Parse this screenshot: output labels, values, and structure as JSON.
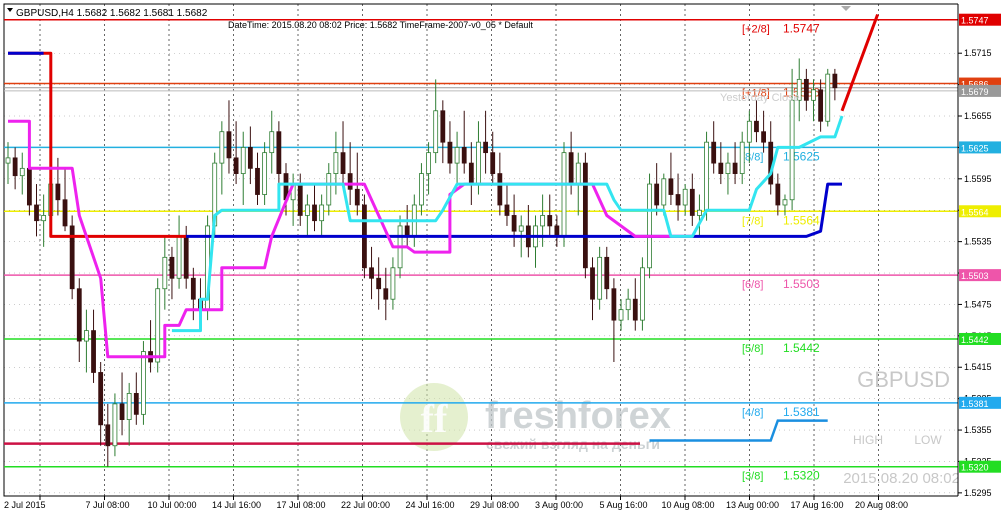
{
  "window": {
    "symbol_header": "GBPUSD,H4  1.5682 1.5682 1.5681 1.5682",
    "info_line": "DateTime: 2015.08.20 08:02    Price: 1.5682    TimeFrame-2007-v0_05    *    Default",
    "watermark_symbol": "GBPUSD",
    "watermark_datetime": "2015.08.20 08:02",
    "high_label": "HIGH",
    "low_label": "LOW",
    "logo_brand": "freshforex",
    "logo_tagline": "свежий взгляд на деньги",
    "yesterday_close_text": "Yesterday Close"
  },
  "colors": {
    "background": "#ffffff",
    "candle_bull": "#2e7d32",
    "candle_bear": "#3a1010",
    "red_line": "#e00000",
    "blue_line": "#0000cc",
    "cyan_line": "#33e5f0",
    "magenta_line": "#ee22ee",
    "grid": "#000000"
  },
  "chart_data": {
    "type": "candlestick",
    "title": "GBPUSD,H4",
    "ylim": [
      1.5292,
      1.5762
    ],
    "y_ticks": [
      "1.5715",
      "1.5685",
      "1.5655",
      "1.5625",
      "1.5595",
      "1.5565",
      "1.5535",
      "1.5505",
      "1.5475",
      "1.5445",
      "1.5415",
      "1.5385",
      "1.5355",
      "1.5325",
      "1.5295"
    ],
    "x_ticks": [
      "2 Jul 2015",
      "7 Jul 08:00",
      "10 Jul 00:00",
      "14 Jul 16:00",
      "17 Jul 08:00",
      "22 Jul 00:00",
      "24 Jul 16:00",
      "29 Jul 08:00",
      "3 Aug 00:00",
      "5 Aug 16:00",
      "10 Aug 08:00",
      "13 Aug 00:00",
      "17 Aug 16:00",
      "20 Aug 08:00"
    ],
    "current_price": 1.5682,
    "murrey_levels": [
      {
        "name": "[+2/8]",
        "value": 1.5747,
        "color": "#e00000",
        "tag": "1.5747"
      },
      {
        "name": "[+1/8]",
        "value": 1.5686,
        "color": "#e04010",
        "tag": "1.5686"
      },
      {
        "name": "[8/8]",
        "value": 1.5625,
        "color": "#22b0e0",
        "tag": "1.5625"
      },
      {
        "name": "[7/8]",
        "value": 1.5564,
        "color": "#eeee00",
        "tag": "1.5564"
      },
      {
        "name": "[6/8]",
        "value": 1.5503,
        "color": "#ee55aa",
        "tag": "1.5503"
      },
      {
        "name": "[5/8]",
        "value": 1.5442,
        "color": "#22dd22",
        "tag": "1.5442"
      },
      {
        "name": "[4/8]",
        "value": 1.5381,
        "color": "#22aaee",
        "tag": "1.5381"
      },
      {
        "name": "[3/8]",
        "value": 1.532,
        "color": "#22dd22",
        "tag": "1.5320"
      }
    ],
    "extra_tags": [
      {
        "value": 1.5679,
        "tag": "1.5679"
      }
    ],
    "candles": [
      {
        "o": 1.561,
        "h": 1.563,
        "l": 1.559,
        "c": 1.5615
      },
      {
        "o": 1.5615,
        "h": 1.5625,
        "l": 1.5585,
        "c": 1.5598
      },
      {
        "o": 1.5598,
        "h": 1.562,
        "l": 1.558,
        "c": 1.5605
      },
      {
        "o": 1.5605,
        "h": 1.5622,
        "l": 1.556,
        "c": 1.557
      },
      {
        "o": 1.557,
        "h": 1.559,
        "l": 1.554,
        "c": 1.5555
      },
      {
        "o": 1.5555,
        "h": 1.558,
        "l": 1.553,
        "c": 1.556
      },
      {
        "o": 1.556,
        "h": 1.56,
        "l": 1.5545,
        "c": 1.559
      },
      {
        "o": 1.559,
        "h": 1.5615,
        "l": 1.556,
        "c": 1.5575
      },
      {
        "o": 1.5575,
        "h": 1.5605,
        "l": 1.5545,
        "c": 1.555
      },
      {
        "o": 1.555,
        "h": 1.556,
        "l": 1.548,
        "c": 1.549
      },
      {
        "o": 1.549,
        "h": 1.55,
        "l": 1.542,
        "c": 1.544
      },
      {
        "o": 1.544,
        "h": 1.547,
        "l": 1.541,
        "c": 1.545
      },
      {
        "o": 1.545,
        "h": 1.547,
        "l": 1.54,
        "c": 1.541
      },
      {
        "o": 1.541,
        "h": 1.542,
        "l": 1.534,
        "c": 1.536
      },
      {
        "o": 1.536,
        "h": 1.538,
        "l": 1.532,
        "c": 1.534
      },
      {
        "o": 1.534,
        "h": 1.539,
        "l": 1.533,
        "c": 1.538
      },
      {
        "o": 1.538,
        "h": 1.541,
        "l": 1.535,
        "c": 1.5365
      },
      {
        "o": 1.5365,
        "h": 1.54,
        "l": 1.534,
        "c": 1.539
      },
      {
        "o": 1.539,
        "h": 1.541,
        "l": 1.536,
        "c": 1.537
      },
      {
        "o": 1.537,
        "h": 1.544,
        "l": 1.536,
        "c": 1.543
      },
      {
        "o": 1.543,
        "h": 1.546,
        "l": 1.541,
        "c": 1.542
      },
      {
        "o": 1.542,
        "h": 1.55,
        "l": 1.541,
        "c": 1.549
      },
      {
        "o": 1.549,
        "h": 1.554,
        "l": 1.547,
        "c": 1.552
      },
      {
        "o": 1.552,
        "h": 1.553,
        "l": 1.548,
        "c": 1.55
      },
      {
        "o": 1.55,
        "h": 1.556,
        "l": 1.549,
        "c": 1.554
      },
      {
        "o": 1.554,
        "h": 1.555,
        "l": 1.549,
        "c": 1.55
      },
      {
        "o": 1.55,
        "h": 1.551,
        "l": 1.546,
        "c": 1.548
      },
      {
        "o": 1.548,
        "h": 1.55,
        "l": 1.545,
        "c": 1.547
      },
      {
        "o": 1.547,
        "h": 1.556,
        "l": 1.546,
        "c": 1.555
      },
      {
        "o": 1.555,
        "h": 1.562,
        "l": 1.554,
        "c": 1.561
      },
      {
        "o": 1.561,
        "h": 1.565,
        "l": 1.558,
        "c": 1.564
      },
      {
        "o": 1.564,
        "h": 1.567,
        "l": 1.56,
        "c": 1.5615
      },
      {
        "o": 1.5615,
        "h": 1.565,
        "l": 1.559,
        "c": 1.56
      },
      {
        "o": 1.56,
        "h": 1.564,
        "l": 1.557,
        "c": 1.5625
      },
      {
        "o": 1.5625,
        "h": 1.5645,
        "l": 1.559,
        "c": 1.5605
      },
      {
        "o": 1.5605,
        "h": 1.562,
        "l": 1.557,
        "c": 1.558
      },
      {
        "o": 1.558,
        "h": 1.563,
        "l": 1.557,
        "c": 1.562
      },
      {
        "o": 1.562,
        "h": 1.566,
        "l": 1.56,
        "c": 1.564
      },
      {
        "o": 1.564,
        "h": 1.565,
        "l": 1.559,
        "c": 1.56
      },
      {
        "o": 1.56,
        "h": 1.561,
        "l": 1.556,
        "c": 1.5575
      },
      {
        "o": 1.5575,
        "h": 1.56,
        "l": 1.555,
        "c": 1.559
      },
      {
        "o": 1.559,
        "h": 1.56,
        "l": 1.555,
        "c": 1.556
      },
      {
        "o": 1.556,
        "h": 1.558,
        "l": 1.554,
        "c": 1.557
      },
      {
        "o": 1.557,
        "h": 1.559,
        "l": 1.5545,
        "c": 1.5555
      },
      {
        "o": 1.5555,
        "h": 1.558,
        "l": 1.554,
        "c": 1.557
      },
      {
        "o": 1.557,
        "h": 1.561,
        "l": 1.556,
        "c": 1.56
      },
      {
        "o": 1.56,
        "h": 1.564,
        "l": 1.558,
        "c": 1.562
      },
      {
        "o": 1.562,
        "h": 1.565,
        "l": 1.559,
        "c": 1.56
      },
      {
        "o": 1.56,
        "h": 1.563,
        "l": 1.557,
        "c": 1.5585
      },
      {
        "o": 1.5585,
        "h": 1.562,
        "l": 1.556,
        "c": 1.557
      },
      {
        "o": 1.557,
        "h": 1.558,
        "l": 1.55,
        "c": 1.551
      },
      {
        "o": 1.551,
        "h": 1.553,
        "l": 1.548,
        "c": 1.55
      },
      {
        "o": 1.55,
        "h": 1.552,
        "l": 1.547,
        "c": 1.549
      },
      {
        "o": 1.549,
        "h": 1.551,
        "l": 1.546,
        "c": 1.548
      },
      {
        "o": 1.548,
        "h": 1.552,
        "l": 1.547,
        "c": 1.551
      },
      {
        "o": 1.551,
        "h": 1.556,
        "l": 1.55,
        "c": 1.555
      },
      {
        "o": 1.555,
        "h": 1.557,
        "l": 1.553,
        "c": 1.554
      },
      {
        "o": 1.554,
        "h": 1.558,
        "l": 1.553,
        "c": 1.557
      },
      {
        "o": 1.557,
        "h": 1.561,
        "l": 1.556,
        "c": 1.56
      },
      {
        "o": 1.56,
        "h": 1.563,
        "l": 1.558,
        "c": 1.562
      },
      {
        "o": 1.562,
        "h": 1.569,
        "l": 1.561,
        "c": 1.566
      },
      {
        "o": 1.566,
        "h": 1.567,
        "l": 1.561,
        "c": 1.563
      },
      {
        "o": 1.563,
        "h": 1.565,
        "l": 1.56,
        "c": 1.561
      },
      {
        "o": 1.561,
        "h": 1.564,
        "l": 1.559,
        "c": 1.5625
      },
      {
        "o": 1.5625,
        "h": 1.566,
        "l": 1.56,
        "c": 1.561
      },
      {
        "o": 1.561,
        "h": 1.563,
        "l": 1.557,
        "c": 1.559
      },
      {
        "o": 1.559,
        "h": 1.565,
        "l": 1.558,
        "c": 1.563
      },
      {
        "o": 1.563,
        "h": 1.566,
        "l": 1.56,
        "c": 1.562
      },
      {
        "o": 1.562,
        "h": 1.564,
        "l": 1.559,
        "c": 1.56
      },
      {
        "o": 1.56,
        "h": 1.562,
        "l": 1.556,
        "c": 1.557
      },
      {
        "o": 1.557,
        "h": 1.559,
        "l": 1.555,
        "c": 1.556
      },
      {
        "o": 1.556,
        "h": 1.558,
        "l": 1.553,
        "c": 1.5545
      },
      {
        "o": 1.5545,
        "h": 1.556,
        "l": 1.552,
        "c": 1.555
      },
      {
        "o": 1.555,
        "h": 1.557,
        "l": 1.552,
        "c": 1.553
      },
      {
        "o": 1.553,
        "h": 1.556,
        "l": 1.551,
        "c": 1.555
      },
      {
        "o": 1.555,
        "h": 1.558,
        "l": 1.553,
        "c": 1.556
      },
      {
        "o": 1.556,
        "h": 1.558,
        "l": 1.554,
        "c": 1.555
      },
      {
        "o": 1.555,
        "h": 1.556,
        "l": 1.553,
        "c": 1.554
      },
      {
        "o": 1.554,
        "h": 1.563,
        "l": 1.553,
        "c": 1.562
      },
      {
        "o": 1.562,
        "h": 1.564,
        "l": 1.558,
        "c": 1.559
      },
      {
        "o": 1.559,
        "h": 1.562,
        "l": 1.556,
        "c": 1.561
      },
      {
        "o": 1.561,
        "h": 1.562,
        "l": 1.55,
        "c": 1.551
      },
      {
        "o": 1.551,
        "h": 1.552,
        "l": 1.546,
        "c": 1.548
      },
      {
        "o": 1.548,
        "h": 1.553,
        "l": 1.547,
        "c": 1.552
      },
      {
        "o": 1.552,
        "h": 1.553,
        "l": 1.548,
        "c": 1.549
      },
      {
        "o": 1.549,
        "h": 1.55,
        "l": 1.542,
        "c": 1.546
      },
      {
        "o": 1.546,
        "h": 1.548,
        "l": 1.545,
        "c": 1.547
      },
      {
        "o": 1.547,
        "h": 1.549,
        "l": 1.546,
        "c": 1.548
      },
      {
        "o": 1.548,
        "h": 1.55,
        "l": 1.545,
        "c": 1.546
      },
      {
        "o": 1.546,
        "h": 1.552,
        "l": 1.545,
        "c": 1.551
      },
      {
        "o": 1.551,
        "h": 1.56,
        "l": 1.55,
        "c": 1.559
      },
      {
        "o": 1.559,
        "h": 1.561,
        "l": 1.556,
        "c": 1.557
      },
      {
        "o": 1.557,
        "h": 1.56,
        "l": 1.556,
        "c": 1.5595
      },
      {
        "o": 1.5595,
        "h": 1.562,
        "l": 1.557,
        "c": 1.558
      },
      {
        "o": 1.558,
        "h": 1.56,
        "l": 1.5555,
        "c": 1.557
      },
      {
        "o": 1.557,
        "h": 1.559,
        "l": 1.556,
        "c": 1.5585
      },
      {
        "o": 1.5585,
        "h": 1.56,
        "l": 1.555,
        "c": 1.556
      },
      {
        "o": 1.556,
        "h": 1.558,
        "l": 1.554,
        "c": 1.5565
      },
      {
        "o": 1.5565,
        "h": 1.564,
        "l": 1.5555,
        "c": 1.563
      },
      {
        "o": 1.563,
        "h": 1.565,
        "l": 1.56,
        "c": 1.561
      },
      {
        "o": 1.561,
        "h": 1.563,
        "l": 1.559,
        "c": 1.56
      },
      {
        "o": 1.56,
        "h": 1.562,
        "l": 1.558,
        "c": 1.561
      },
      {
        "o": 1.561,
        "h": 1.563,
        "l": 1.559,
        "c": 1.56
      },
      {
        "o": 1.56,
        "h": 1.564,
        "l": 1.559,
        "c": 1.563
      },
      {
        "o": 1.563,
        "h": 1.566,
        "l": 1.561,
        "c": 1.565
      },
      {
        "o": 1.565,
        "h": 1.567,
        "l": 1.563,
        "c": 1.564
      },
      {
        "o": 1.564,
        "h": 1.566,
        "l": 1.562,
        "c": 1.563
      },
      {
        "o": 1.563,
        "h": 1.565,
        "l": 1.558,
        "c": 1.559
      },
      {
        "o": 1.559,
        "h": 1.56,
        "l": 1.556,
        "c": 1.557
      },
      {
        "o": 1.557,
        "h": 1.558,
        "l": 1.556,
        "c": 1.5575
      },
      {
        "o": 1.5575,
        "h": 1.57,
        "l": 1.5565,
        "c": 1.567
      },
      {
        "o": 1.567,
        "h": 1.571,
        "l": 1.565,
        "c": 1.569
      },
      {
        "o": 1.569,
        "h": 1.57,
        "l": 1.566,
        "c": 1.567
      },
      {
        "o": 1.567,
        "h": 1.569,
        "l": 1.565,
        "c": 1.568
      },
      {
        "o": 1.568,
        "h": 1.569,
        "l": 1.564,
        "c": 1.565
      },
      {
        "o": 1.565,
        "h": 1.57,
        "l": 1.5645,
        "c": 1.5695
      },
      {
        "o": 1.5695,
        "h": 1.57,
        "l": 1.567,
        "c": 1.5682
      }
    ],
    "series": [
      {
        "name": "red",
        "color": "#e00000",
        "points": [
          [
            0,
            1.5715
          ],
          [
            6,
            1.5715
          ],
          [
            6,
            1.554
          ],
          [
            25,
            1.554
          ]
        ]
      },
      {
        "name": "blue",
        "color": "#0000cc",
        "points": [
          [
            0,
            1.5715
          ],
          [
            5,
            1.5715
          ]
        ]
      },
      {
        "name": "blue2",
        "color": "#0000cc",
        "points": [
          [
            25,
            1.554
          ],
          [
            110,
            1.554
          ],
          [
            112,
            1.554
          ],
          [
            114,
            1.5545
          ],
          [
            115,
            1.559
          ],
          [
            117,
            1.559
          ]
        ]
      },
      {
        "name": "magenta",
        "color": "#ee22ee",
        "points": [
          [
            0,
            1.565
          ],
          [
            3,
            1.565
          ],
          [
            3,
            1.5605
          ],
          [
            9,
            1.5605
          ],
          [
            10,
            1.556
          ],
          [
            13,
            1.55
          ],
          [
            14,
            1.5425
          ],
          [
            22,
            1.5425
          ],
          [
            22,
            1.5455
          ],
          [
            24,
            1.5455
          ],
          [
            25,
            1.547
          ],
          [
            30,
            1.547
          ],
          [
            30,
            1.551
          ],
          [
            36,
            1.551
          ],
          [
            37,
            1.554
          ],
          [
            40,
            1.559
          ],
          [
            50,
            1.559
          ],
          [
            52,
            1.556
          ],
          [
            54,
            1.553
          ],
          [
            56,
            1.553
          ],
          [
            57,
            1.5525
          ],
          [
            62,
            1.5525
          ],
          [
            62,
            1.558
          ],
          [
            64,
            1.559
          ],
          [
            82,
            1.559
          ],
          [
            84,
            1.556
          ],
          [
            88,
            1.554
          ],
          [
            96,
            1.554
          ]
        ]
      },
      {
        "name": "cyan",
        "color": "#33e5f0",
        "points": [
          [
            23,
            1.545
          ],
          [
            27,
            1.545
          ],
          [
            27,
            1.548
          ],
          [
            28,
            1.548
          ],
          [
            29,
            1.556
          ],
          [
            30,
            1.5565
          ],
          [
            38,
            1.5565
          ],
          [
            38,
            1.559
          ],
          [
            47,
            1.559
          ],
          [
            48,
            1.5555
          ],
          [
            60,
            1.5555
          ],
          [
            61,
            1.5565
          ],
          [
            63,
            1.559
          ],
          [
            84,
            1.559
          ],
          [
            85,
            1.5575
          ],
          [
            86,
            1.5565
          ],
          [
            92,
            1.5565
          ],
          [
            93,
            1.554
          ],
          [
            96,
            1.554
          ],
          [
            98,
            1.5565
          ],
          [
            104,
            1.5565
          ],
          [
            105,
            1.5585
          ],
          [
            107,
            1.56
          ],
          [
            108,
            1.5625
          ],
          [
            111,
            1.5625
          ],
          [
            114,
            1.5635
          ],
          [
            116,
            1.5635
          ],
          [
            117,
            1.5655
          ]
        ]
      },
      {
        "name": "arrow-red",
        "color": "#e00000",
        "points": [
          [
            117,
            1.566
          ],
          [
            122,
            1.5752
          ]
        ]
      }
    ],
    "fourth_level_blue": [
      [
        90,
        1.5345
      ],
      [
        107,
        1.5345
      ],
      [
        108,
        1.5364
      ],
      [
        115,
        1.5364
      ]
    ]
  }
}
